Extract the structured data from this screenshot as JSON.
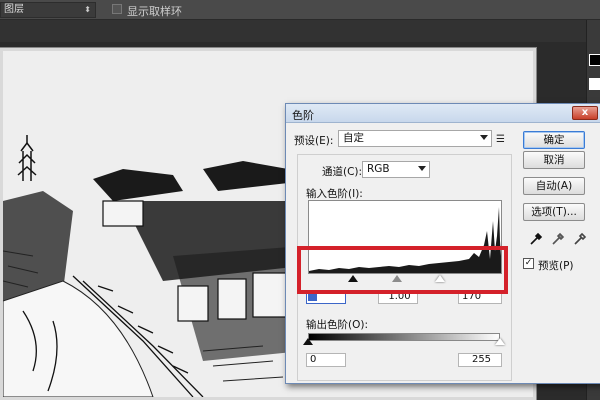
{
  "optbar": {
    "layer_select": "图层",
    "show_sampling_ring": "显示取样环"
  },
  "dialog": {
    "title": "色阶",
    "close_glyph": "x",
    "preset_label": "预设(E):",
    "preset_value": "自定",
    "channel_label": "通道(C):",
    "channel_value": "RGB",
    "input_levels_label": "输入色阶(I):",
    "input_black": "",
    "input_gamma": "1.00",
    "input_white": "170",
    "output_levels_label": "输出色阶(O):",
    "output_black": "0",
    "output_white": "255",
    "buttons": {
      "ok": "确定",
      "cancel": "取消",
      "auto": "自动(A)",
      "options": "选项(T)..."
    },
    "preview_label": "预览(P)",
    "preview_checked": "✓"
  },
  "colors": {
    "highlight": "#d4212a",
    "title_gradient": "#c8d8ec"
  }
}
